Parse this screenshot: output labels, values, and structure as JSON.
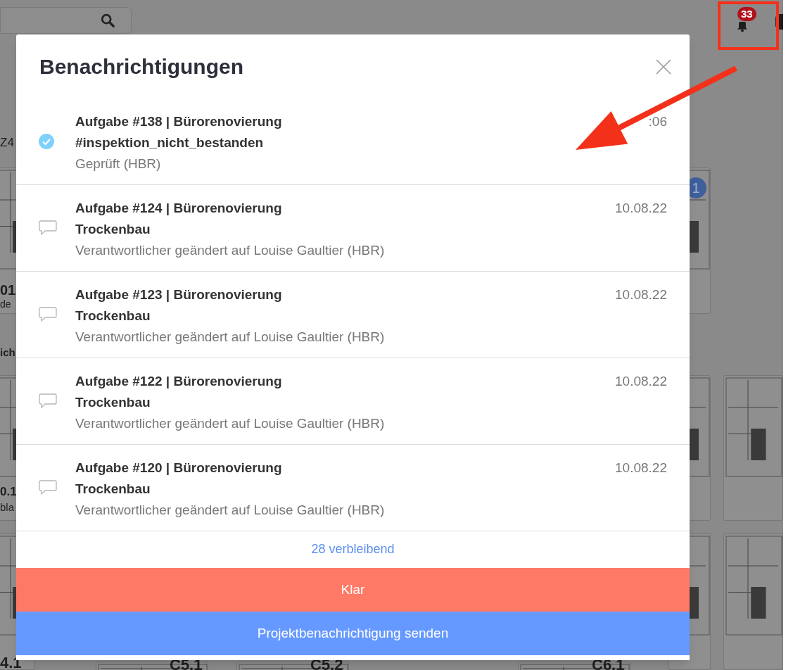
{
  "top_bar": {
    "notification_badge": "33"
  },
  "background": {
    "labels": [
      {
        "text": "Z4"
      },
      {
        "text": "01"
      },
      {
        "text": "de"
      },
      {
        "text": "ich"
      },
      {
        "text": "0.1"
      },
      {
        "text": "bla"
      },
      {
        "text": "4.1"
      },
      {
        "text": "C5.1"
      },
      {
        "text": "C5.2"
      },
      {
        "text": "C6.1"
      }
    ],
    "sheet_badge": "1"
  },
  "dialog": {
    "title": "Benachrichtigungen",
    "items": [
      {
        "kind": "checked",
        "title": "Aufgabe #138 | Bürorenovierung",
        "tag": "#inspektion_nicht_bestanden",
        "detail": "Geprüft (HBR)",
        "date": ":06"
      },
      {
        "kind": "comment",
        "title": "Aufgabe #124 | Bürorenovierung",
        "tag": "Trockenbau",
        "detail": "Verantwortlicher geändert auf Louise Gaultier (HBR)",
        "date": "10.08.22"
      },
      {
        "kind": "comment",
        "title": "Aufgabe #123 | Bürorenovierung",
        "tag": "Trockenbau",
        "detail": "Verantwortlicher geändert auf Louise Gaultier (HBR)",
        "date": "10.08.22"
      },
      {
        "kind": "comment",
        "title": "Aufgabe #122 | Bürorenovierung",
        "tag": "Trockenbau",
        "detail": "Verantwortlicher geändert auf Louise Gaultier (HBR)",
        "date": "10.08.22"
      },
      {
        "kind": "comment",
        "title": "Aufgabe #120 | Bürorenovierung",
        "tag": "Trockenbau",
        "detail": "Verantwortlicher geändert auf Louise Gaultier (HBR)",
        "date": "10.08.22"
      }
    ],
    "remaining": "28 verbleibend",
    "buttons": [
      {
        "kind": "dismiss",
        "label": "Klar"
      },
      {
        "kind": "send",
        "label": "Projektbenachrichtigung senden"
      }
    ]
  }
}
